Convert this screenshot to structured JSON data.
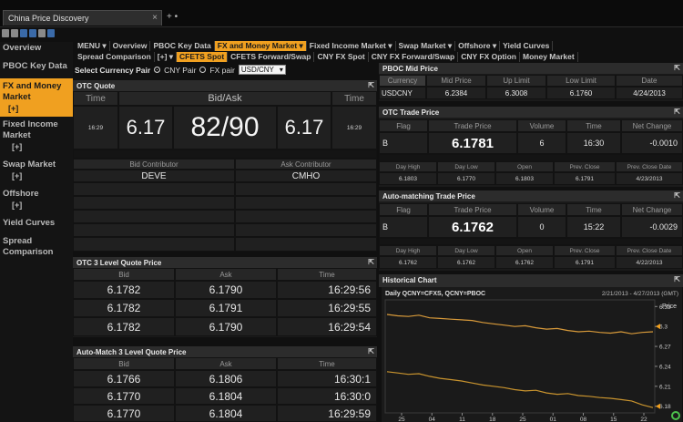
{
  "window": {
    "tab_title": "China Price Discovery",
    "tab_close": "×",
    "tab_plus": "+ •"
  },
  "sidebar": {
    "items": [
      {
        "label": "Overview",
        "sub": ""
      },
      {
        "label": "PBOC Key Data",
        "sub": ""
      },
      {
        "label": "FX and Money Market",
        "sub": "[+]"
      },
      {
        "label": "Fixed Income Market",
        "sub": "[+]"
      },
      {
        "label": "Swap Market",
        "sub": "[+]"
      },
      {
        "label": "Offshore",
        "sub": "[+]"
      },
      {
        "label": "Yield Curves",
        "sub": ""
      },
      {
        "label": "Spread Comparison",
        "sub": ""
      }
    ]
  },
  "menu": {
    "row1": [
      "MENU ▾",
      "Overview",
      "PBOC Key Data",
      "FX and Money Market ▾",
      "Fixed Income Market ▾",
      "Swap Market ▾",
      "Offshore ▾",
      "Yield Curves"
    ],
    "row2": [
      "Spread Comparison",
      "[+] ▾",
      "CFETS Spot",
      "CFETS Forward/Swap",
      "CNY FX Spot",
      "CNY FX Forward/Swap",
      "CNY FX Option",
      "Money Market"
    ]
  },
  "currency": {
    "label": "Select Currency Pair",
    "opt1": "CNY Pair",
    "opt2": "FX pair",
    "selected": "USD/CNY"
  },
  "otc_quote": {
    "title": "OTC Quote",
    "h_time": "Time",
    "h_bidask": "Bid/Ask",
    "h_time2": "Time",
    "time_left": "16:29",
    "bid": "6.17",
    "bidask": "82/90",
    "ask": "6.17",
    "time_right": "16:29",
    "h_bid_contrib": "Bid Contributor",
    "h_ask_contrib": "Ask Contributor",
    "bid_contrib": "DEVE",
    "ask_contrib": "CMHO"
  },
  "otc3": {
    "title": "OTC 3 Level Quote Price",
    "headers": [
      "Bid",
      "Ask",
      "Time"
    ],
    "rows": [
      [
        "6.1782",
        "6.1790",
        "16:29:56"
      ],
      [
        "6.1782",
        "6.1791",
        "16:29:55"
      ],
      [
        "6.1782",
        "6.1790",
        "16:29:54"
      ]
    ]
  },
  "auto3": {
    "title": "Auto-Match 3 Level Quote Price",
    "headers": [
      "Bid",
      "Ask",
      "Time"
    ],
    "rows": [
      [
        "6.1766",
        "6.1806",
        "16:30:1"
      ],
      [
        "6.1770",
        "6.1804",
        "16:30:0"
      ],
      [
        "6.1770",
        "6.1804",
        "16:29:59"
      ]
    ]
  },
  "pboc_mid": {
    "title": "PBOC Mid Price",
    "headers": [
      "Currency",
      "Mid Price",
      "Up Limit",
      "Low Limit",
      "Date"
    ],
    "row": [
      "USDCNY",
      "6.2384",
      "6.3008",
      "6.1760",
      "4/24/2013"
    ]
  },
  "otc_trade": {
    "title": "OTC Trade Price",
    "headers": [
      "Flag",
      "Trade Price",
      "Volume",
      "Time",
      "Net Change"
    ],
    "row": [
      "B",
      "6.1781",
      "6",
      "16:30",
      "-0.0010"
    ],
    "sub_headers": [
      "Day High",
      "Day Low",
      "Open",
      "Prev. Close",
      "Prev. Close Date"
    ],
    "sub_row": [
      "6.1803",
      "6.1770",
      "6.1803",
      "6.1791",
      "4/23/2013"
    ]
  },
  "auto_trade": {
    "title": "Auto-matching Trade Price",
    "headers": [
      "Flag",
      "Trade Price",
      "Volume",
      "Time",
      "Net Change"
    ],
    "row": [
      "B",
      "6.1762",
      "0",
      "15:22",
      "-0.0029"
    ],
    "sub_headers": [
      "Day High",
      "Day Low",
      "Open",
      "Prev. Close",
      "Prev. Close Date"
    ],
    "sub_row": [
      "6.1762",
      "6.1762",
      "6.1762",
      "6.1791",
      "4/22/2013"
    ]
  },
  "historical": {
    "title": "Historical Chart",
    "legend": "Daily QCNY=CFXS, QCNY=PBOC",
    "range": "2/21/2013 - 4/27/2013 (GMT)",
    "ylabel": "Price"
  },
  "chart_data": {
    "type": "line",
    "title": "Daily QCNY=CFXS, QCNY=PBOC",
    "ylabel": "Price",
    "ylim": [
      6.17,
      6.34
    ],
    "y_ticks": [
      "6.33",
      "6.3",
      "6.27",
      "6.24",
      "6.21",
      "6.18"
    ],
    "x_ticks": [
      "25",
      "04",
      "11",
      "18",
      "25",
      "01",
      "08",
      "15",
      "22"
    ],
    "series": [
      {
        "name": "QCNY=PBOC",
        "color": "#d89a3a",
        "values": [
          6.318,
          6.316,
          6.315,
          6.317,
          6.313,
          6.312,
          6.311,
          6.31,
          6.309,
          6.306,
          6.304,
          6.302,
          6.3,
          6.301,
          6.298,
          6.296,
          6.297,
          6.294,
          6.292,
          6.293,
          6.291,
          6.29,
          6.292,
          6.289,
          6.291,
          6.292
        ]
      },
      {
        "name": "QCNY=CFXS",
        "color": "#c8932e",
        "values": [
          6.232,
          6.23,
          6.228,
          6.229,
          6.225,
          6.222,
          6.22,
          6.218,
          6.215,
          6.212,
          6.21,
          6.208,
          6.205,
          6.203,
          6.204,
          6.2,
          6.198,
          6.199,
          6.196,
          6.195,
          6.193,
          6.192,
          6.19,
          6.188,
          6.182,
          6.178
        ]
      }
    ],
    "markers": [
      "6.3",
      "6.18"
    ]
  },
  "colors": {
    "accent": "#f0a020",
    "panel": "#1a1a1a",
    "header": "#2c2c2c",
    "line": "#d89a3a"
  },
  "status": {
    "icon": "refresh-icon"
  }
}
